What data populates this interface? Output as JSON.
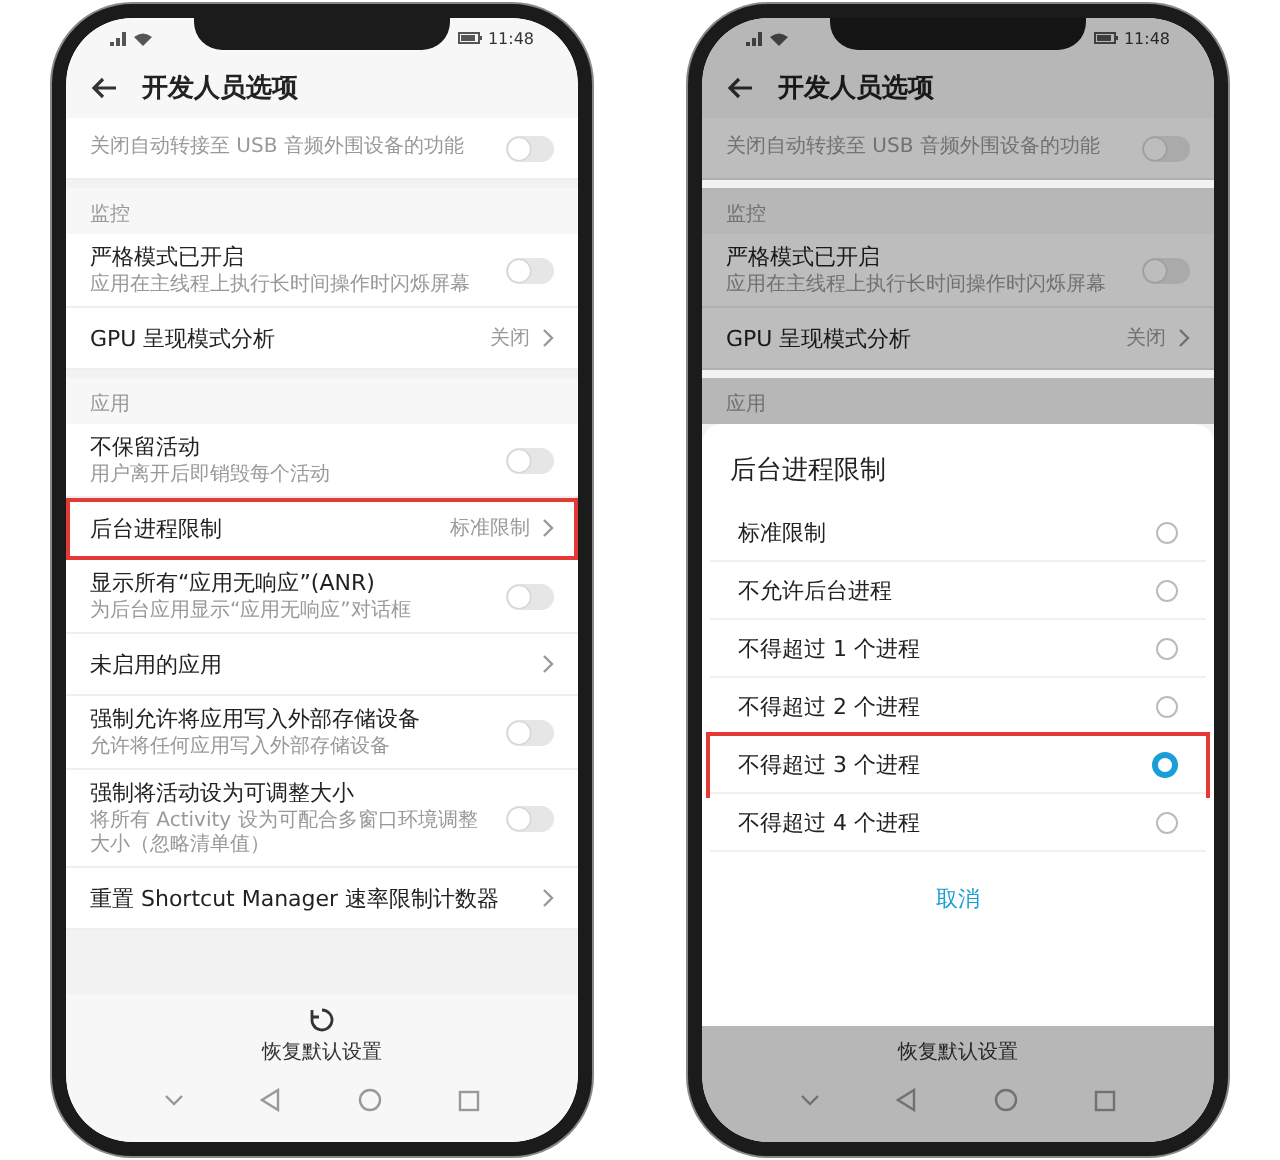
{
  "phones": [
    {
      "status_time": "11:48",
      "title": "开发人员选项",
      "dimmed": false,
      "rows": [
        {
          "kind": "switch",
          "subtitle": "关闭自动转接至 USB 音频外围设备的功能",
          "on": false,
          "highlighted": false
        },
        {
          "kind": "section",
          "label": "监控"
        },
        {
          "kind": "switch",
          "title": "严格模式已开启",
          "subtitle": "应用在主线程上执行长时间操作时闪烁屏幕",
          "on": false,
          "highlighted": false
        },
        {
          "kind": "link",
          "title": "GPU 呈现模式分析",
          "value": "关闭",
          "highlighted": false
        },
        {
          "kind": "section",
          "label": "应用"
        },
        {
          "kind": "switch",
          "title": "不保留活动",
          "subtitle": "用户离开后即销毁每个活动",
          "on": false,
          "highlighted": false
        },
        {
          "kind": "link",
          "title": "后台进程限制",
          "value": "标准限制",
          "highlighted": true
        },
        {
          "kind": "switch",
          "title": "显示所有“应用无响应”(ANR)",
          "subtitle": "为后台应用显示“应用无响应”对话框",
          "on": false,
          "highlighted": false
        },
        {
          "kind": "link",
          "title": "未启用的应用",
          "highlighted": false
        },
        {
          "kind": "switch",
          "title": "强制允许将应用写入外部存储设备",
          "subtitle": "允许将任何应用写入外部存储设备",
          "on": false,
          "highlighted": false
        },
        {
          "kind": "switch",
          "title": "强制将活动设为可调整大小",
          "subtitle": "将所有 Activity 设为可配合多窗口环境调整大小（忽略清单值）",
          "on": false,
          "highlighted": false
        },
        {
          "kind": "link",
          "title": "重置 Shortcut Manager 速率限制计数器",
          "highlighted": false
        }
      ],
      "footer": {
        "label": "恢复默认设置",
        "icon": true
      }
    },
    {
      "status_time": "11:48",
      "title": "开发人员选项",
      "dimmed": true,
      "rows": [
        {
          "kind": "switch",
          "subtitle": "关闭自动转接至 USB 音频外围设备的功能",
          "on": false,
          "highlighted": false
        },
        {
          "kind": "section",
          "label": "监控"
        },
        {
          "kind": "switch",
          "title": "严格模式已开启",
          "subtitle": "应用在主线程上执行长时间操作时闪烁屏幕",
          "on": false,
          "highlighted": false
        },
        {
          "kind": "link",
          "title": "GPU 呈现模式分析",
          "value": "关闭",
          "highlighted": false
        },
        {
          "kind": "section",
          "label": "应用"
        }
      ],
      "dialog": {
        "title": "后台进程限制",
        "options": [
          {
            "label": "标准限制",
            "selected": false,
            "highlighted": false
          },
          {
            "label": "不允许后台进程",
            "selected": false,
            "highlighted": false
          },
          {
            "label": "不得超过 1 个进程",
            "selected": false,
            "highlighted": false
          },
          {
            "label": "不得超过 2 个进程",
            "selected": false,
            "highlighted": false
          },
          {
            "label": "不得超过 3 个进程",
            "selected": true,
            "highlighted": true
          },
          {
            "label": "不得超过 4 个进程",
            "selected": false,
            "highlighted": false
          }
        ],
        "cancel": "取消"
      },
      "footer": {
        "label": "恢复默认设置",
        "icon": false
      }
    }
  ]
}
